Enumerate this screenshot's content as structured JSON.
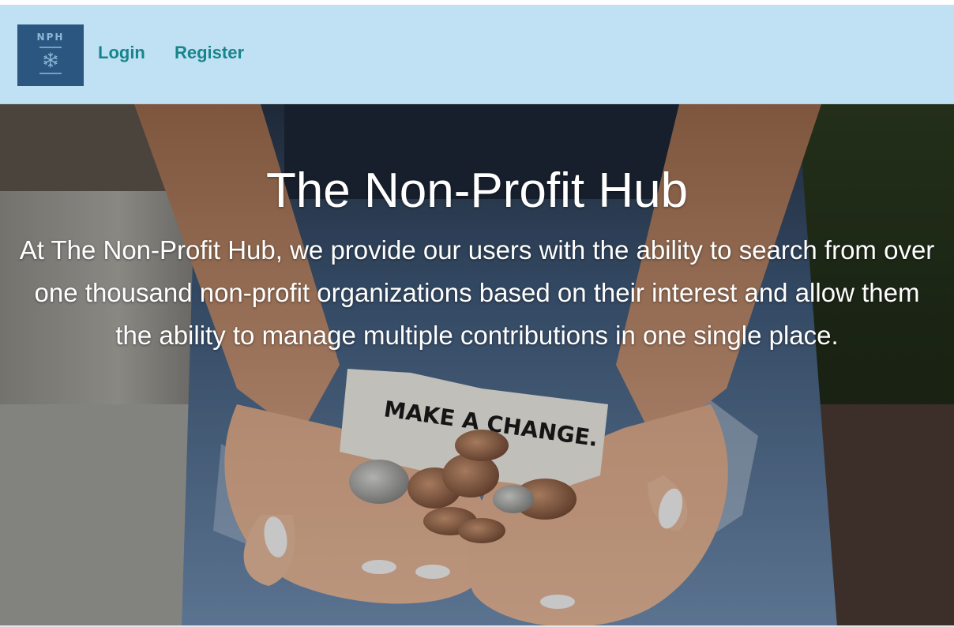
{
  "header": {
    "logo": {
      "text": "NPH",
      "icon": "snowflake-icon"
    },
    "nav": {
      "login_label": "Login",
      "register_label": "Register"
    }
  },
  "hero": {
    "title": "The Non-Profit Hub",
    "description": "At The Non-Profit Hub, we provide our users with the ability to search from over one thousand non-profit organizations based on their interest and allow them the ability to manage multiple contributions in one single place.",
    "image_note_text": "MAKE A CHANGE."
  },
  "colors": {
    "navbar_bg": "#c0e1f3",
    "nav_link": "#17858c",
    "logo_bg": "#2a5680",
    "hero_text": "#ffffff"
  }
}
